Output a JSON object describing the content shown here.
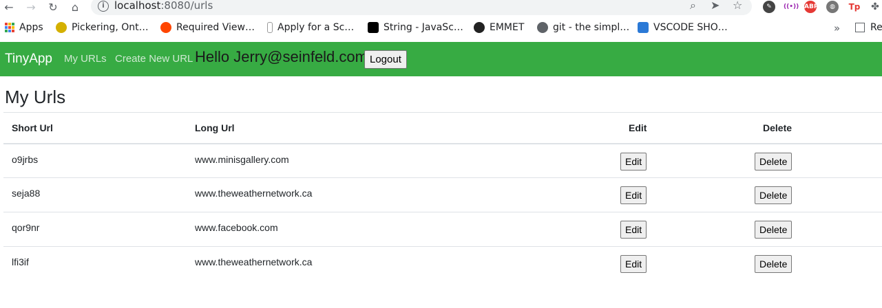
{
  "browser": {
    "url_host": "localhost",
    "url_path": ":8080/urls"
  },
  "bookmarks": [
    {
      "label": "Apps",
      "icon": "apps-grid-icon"
    },
    {
      "label": "Pickering, Ont…",
      "icon": "weather-icon",
      "color": "#d4b000"
    },
    {
      "label": "Required View…",
      "icon": "reddit-icon",
      "color": "#ff4500"
    },
    {
      "label": "Apply for a Sc…",
      "icon": "school-icon",
      "color": "#333333"
    },
    {
      "label": "String - JavaSc…",
      "icon": "mdn-icon",
      "color": "#000000"
    },
    {
      "label": "EMMET",
      "icon": "emmet-icon",
      "color": "#222222"
    },
    {
      "label": "git - the simpl…",
      "icon": "globe-icon",
      "color": "#5f6368"
    },
    {
      "label": "VSCODE SHO…",
      "icon": "vscode-icon",
      "color": "#2b79d6"
    }
  ],
  "reading_list_label": "Re",
  "navbar": {
    "brand": "TinyApp",
    "links": [
      "My URLs",
      "Create New URL"
    ],
    "greeting": "Hello Jerry@seinfeld.com",
    "logout_label": "Logout"
  },
  "page": {
    "title": "My Urls",
    "columns": [
      "Short Url",
      "Long Url",
      "Edit",
      "Delete"
    ],
    "rows": [
      {
        "short": "o9jrbs",
        "long": "www.minisgallery.com"
      },
      {
        "short": "seja88",
        "long": "www.theweathernetwork.ca"
      },
      {
        "short": "qor9nr",
        "long": "www.facebook.com"
      },
      {
        "short": "lfi3if",
        "long": "www.theweathernetwork.ca"
      }
    ],
    "edit_label": "Edit",
    "delete_label": "Delete"
  },
  "colors": {
    "navbar_bg": "#37ab43"
  }
}
